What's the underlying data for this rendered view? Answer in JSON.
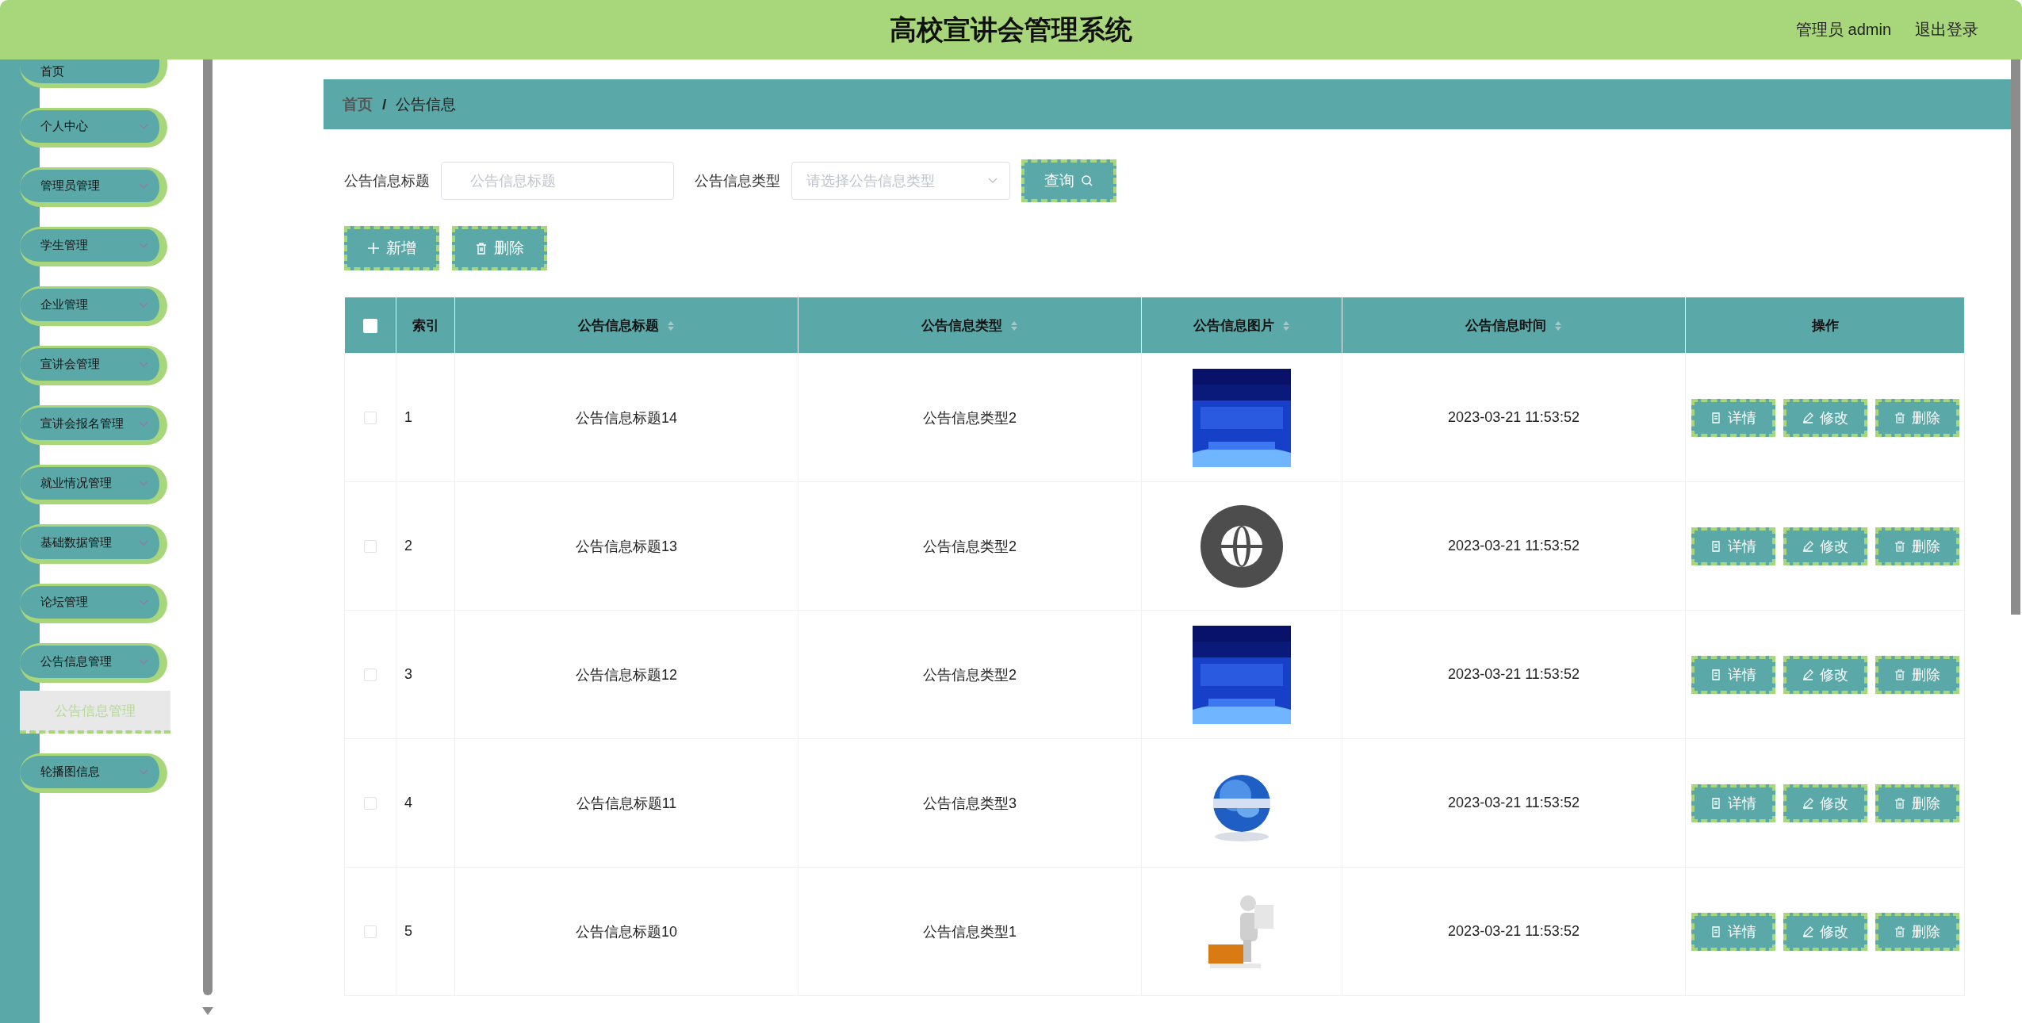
{
  "header": {
    "title": "高校宣讲会管理系统",
    "user": "管理员 admin",
    "logout": "退出登录"
  },
  "sidebar": {
    "items": [
      {
        "label": "首页",
        "kind": "link"
      },
      {
        "label": "个人中心",
        "kind": "menu"
      },
      {
        "label": "管理员管理",
        "kind": "menu"
      },
      {
        "label": "学生管理",
        "kind": "menu"
      },
      {
        "label": "企业管理",
        "kind": "menu"
      },
      {
        "label": "宣讲会管理",
        "kind": "menu"
      },
      {
        "label": "宣讲会报名管理",
        "kind": "menu"
      },
      {
        "label": "就业情况管理",
        "kind": "menu"
      },
      {
        "label": "基础数据管理",
        "kind": "menu"
      },
      {
        "label": "论坛管理",
        "kind": "menu"
      },
      {
        "label": "公告信息管理",
        "kind": "menu",
        "children": [
          {
            "label": "公告信息管理",
            "selected": true
          }
        ]
      },
      {
        "label": "轮播图信息",
        "kind": "menu"
      }
    ]
  },
  "breadcrumb": {
    "items": [
      "首页",
      "公告信息"
    ],
    "separator": "/"
  },
  "search": {
    "fields": [
      {
        "kind": "input",
        "label": "公告信息标题",
        "placeholder": "公告信息标题"
      },
      {
        "kind": "select",
        "label": "公告信息类型",
        "placeholder": "请选择公告信息类型"
      }
    ],
    "button": "查询"
  },
  "actions": [
    {
      "kind": "add",
      "label": "新增"
    },
    {
      "kind": "delete",
      "label": "删除"
    }
  ],
  "table": {
    "header_checked": false,
    "columns": [
      {
        "label": "索引",
        "sortable": false
      },
      {
        "label": "公告信息标题",
        "sortable": true
      },
      {
        "label": "公告信息类型",
        "sortable": true
      },
      {
        "label": "公告信息图片",
        "sortable": true
      },
      {
        "label": "公告信息时间",
        "sortable": true
      },
      {
        "label": "操作",
        "sortable": false
      }
    ],
    "rows": [
      {
        "checked": false,
        "index": "1",
        "title": "公告信息标题14",
        "type": "公告信息类型2",
        "time": "2023-03-21 11:53:52",
        "actions": [
          {
            "kind": "detail",
            "label": "详情"
          },
          {
            "kind": "edit",
            "label": "修改"
          },
          {
            "kind": "delete",
            "label": "删除"
          }
        ]
      },
      {
        "checked": false,
        "index": "2",
        "title": "公告信息标题13",
        "type": "公告信息类型2",
        "time": "2023-03-21 11:53:52",
        "actions": [
          {
            "kind": "detail",
            "label": "详情"
          },
          {
            "kind": "edit",
            "label": "修改"
          },
          {
            "kind": "delete",
            "label": "删除"
          }
        ]
      },
      {
        "checked": false,
        "index": "3",
        "title": "公告信息标题12",
        "type": "公告信息类型2",
        "time": "2023-03-21 11:53:52",
        "actions": [
          {
            "kind": "detail",
            "label": "详情"
          },
          {
            "kind": "edit",
            "label": "修改"
          },
          {
            "kind": "delete",
            "label": "删除"
          }
        ]
      },
      {
        "checked": false,
        "index": "4",
        "title": "公告信息标题11",
        "type": "公告信息类型3",
        "time": "2023-03-21 11:53:52",
        "actions": [
          {
            "kind": "detail",
            "label": "详情"
          },
          {
            "kind": "edit",
            "label": "修改"
          },
          {
            "kind": "delete",
            "label": "删除"
          }
        ]
      },
      {
        "checked": false,
        "index": "5",
        "title": "公告信息标题10",
        "type": "公告信息类型1",
        "time": "2023-03-21 11:53:52",
        "actions": [
          {
            "kind": "detail",
            "label": "详情"
          },
          {
            "kind": "edit",
            "label": "修改"
          },
          {
            "kind": "delete",
            "label": "删除"
          }
        ]
      }
    ]
  }
}
